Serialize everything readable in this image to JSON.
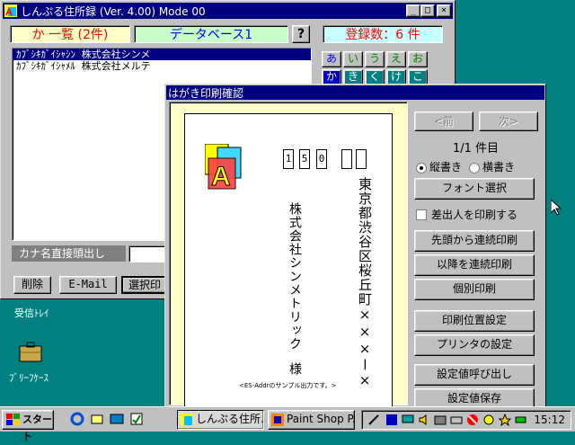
{
  "main_window": {
    "title": "しんぷる住所録 (Ver. 4.00) Mode 00",
    "list_header": "か 一覧 (2件)",
    "db_name": "データベース1",
    "help_label": "?",
    "count_label": "登録数：6 件",
    "list_items": [
      "ｶﾌﾞｼｷｶﾞｲｼｬｼﾝ 株式会社シンメ",
      "ｶﾌﾞｼｷｶﾞｲｼｬﾒﾙ 株式会社メルテ"
    ],
    "kana_row1": [
      "あ",
      "い",
      "う",
      "え",
      "お"
    ],
    "kana_row2": [
      "か",
      "き",
      "く",
      "け",
      "こ"
    ],
    "kana_search_label": "カナ名直接頭出し",
    "buttons": {
      "delete": "削除",
      "email": "E-Mail",
      "select_print": "選択印"
    }
  },
  "desktop": {
    "partial_label": "受信ﾄﾚｲ",
    "briefcase_label": "ﾌﾞﾘｰﾌｹｰｽ"
  },
  "dialog": {
    "title": "はがき印刷確認",
    "zip_digits": [
      "1",
      "5",
      "0",
      "",
      ""
    ],
    "address": "東京都渋谷区桜丘町×××ー×",
    "recipient": "株式会社シンメトリック",
    "honorific": "様",
    "sample_note": "<ES-Addrのサンプル出力です。>",
    "prev": "<前",
    "next": "次>",
    "page": "1/1 件目",
    "vertical": "縦書き",
    "horizontal": "横書き",
    "orientation_selected": "vertical",
    "font_select": "フォント選択",
    "print_sender": "差出人を印刷する",
    "print_sender_checked": false,
    "print_from_start": "先頭から連続印刷",
    "print_after": "以降を連続印刷",
    "print_single": "個別印刷",
    "print_position": "印刷位置設定",
    "printer_settings": "プリンタの設定",
    "load_settings": "設定値呼び出し",
    "save_settings": "設定値保存"
  },
  "taskbar": {
    "start": "スタート",
    "task1": "しんぷる住所...",
    "task2": "Paint Shop P...",
    "clock": "15:12"
  },
  "colors": {
    "desktop": "#008080",
    "titlebar": "#000080",
    "list_header_bg": "#ffffc8",
    "db_bg": "#c8ffc8",
    "count_bg": "#c8ffff"
  }
}
